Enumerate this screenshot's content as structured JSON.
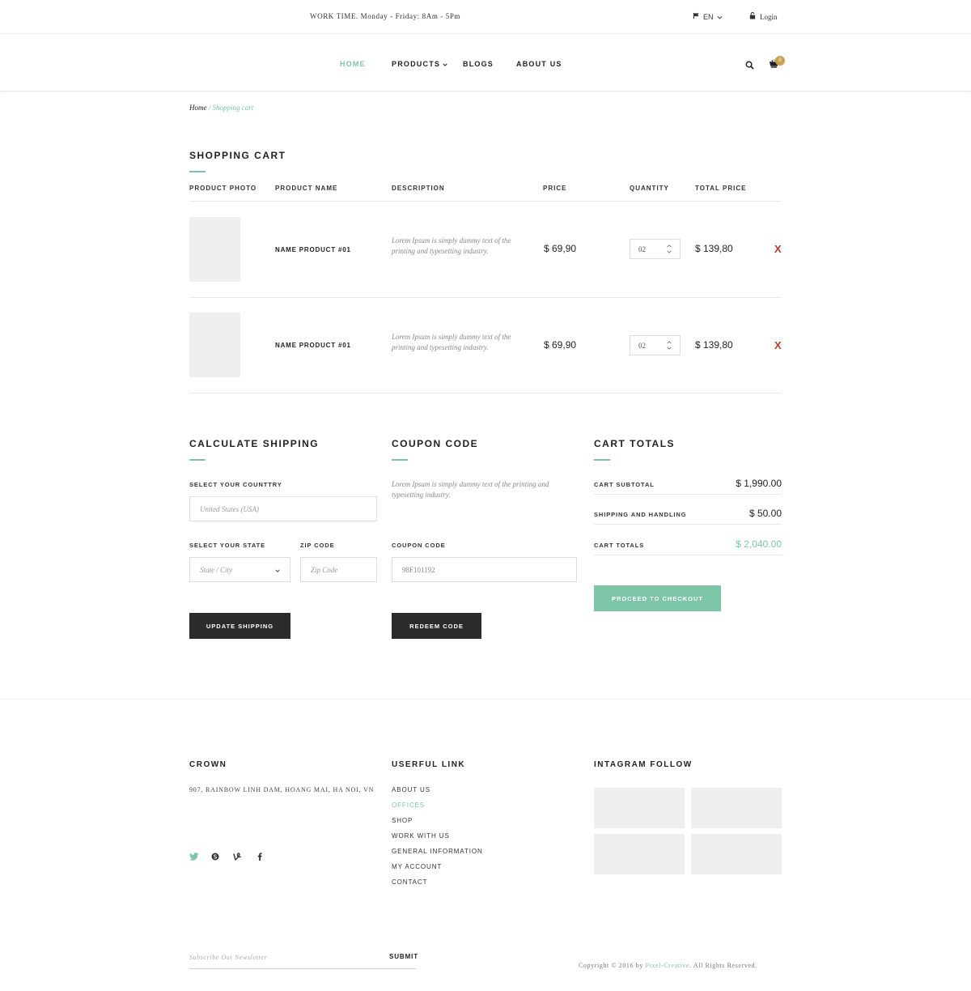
{
  "topbar": {
    "work_time": "WORK TIME. Monday - Friday: 8Am - 5Pm",
    "language": "EN",
    "login": "Login"
  },
  "nav": {
    "items": [
      {
        "label": "HOME",
        "active": true
      },
      {
        "label": "PRODUCTS",
        "has_dropdown": true
      },
      {
        "label": "BLOGS"
      },
      {
        "label": "ABOUT US"
      }
    ],
    "cart_count": "0"
  },
  "breadcrumb": {
    "home": "Home",
    "separator": " / ",
    "current": "Shopping cart"
  },
  "cart": {
    "title": "SHOPPING CART",
    "headers": {
      "photo": "PRODUCT PHOTO",
      "name": "PRODUCT NAME",
      "description": "DESCRIPTION",
      "price": "PRICE",
      "quantity": "QUANTITY",
      "total": "TOTAL PRICE"
    },
    "items": [
      {
        "name": "NAME PRODUCT #01",
        "description": "Lorem Ipsum is simply dummy text of the printing and typesetting industry.",
        "price": "$ 69,90",
        "quantity": "02",
        "total": "$ 139,80",
        "remove": "X"
      },
      {
        "name": "NAME PRODUCT #01",
        "description": "Lorem Ipsum is simply dummy text of the printing and typesetting industry.",
        "price": "$ 69,90",
        "quantity": "02",
        "total": "$ 139,80",
        "remove": "X"
      }
    ]
  },
  "shipping": {
    "title": "CALCULATE SHIPPING",
    "country_label": "SELECT YOUR COUNTTRY",
    "country_value": "United States (USA)",
    "state_label": "SELECT YOUR STATE",
    "state_placeholder": "State / City",
    "zip_label": "ZIP CODE",
    "zip_placeholder": "Zip Code",
    "button": "UPDATE SHIPPING"
  },
  "coupon": {
    "title": "COUPON CODE",
    "description": "Lorem Ipsum is simply dummy text of the printing and typesetting industry.",
    "label": "COUPON CODE",
    "value": "98F101192",
    "button": "REDEEM CODE"
  },
  "totals": {
    "title": "CART TOTALS",
    "subtotal_label": "CART SUBTOTAL",
    "subtotal_value": "$ 1,990.00",
    "shipping_label": "SHIPPING AND HANDLING",
    "shipping_value": "$ 50.00",
    "total_label": "CART TOTALS",
    "total_value": "$ 2,040.00",
    "checkout_button": "PROCEED TO CHECKOUT"
  },
  "footer": {
    "crown_title": "CROWN",
    "address": "907, RAINBOW LINH DAM, HOANG MAI, HA NOI, VN",
    "social": [
      "twitter-icon",
      "skype-icon",
      "vine-icon",
      "facebook-icon"
    ],
    "links_title": "USERFUL LINK",
    "links": [
      {
        "label": "ABOUT US"
      },
      {
        "label": "OFFICES",
        "active": true
      },
      {
        "label": "SHOP"
      },
      {
        "label": "WORK WITH US"
      },
      {
        "label": "GENERAL INFORMATION"
      },
      {
        "label": "MY ACCOUNT"
      },
      {
        "label": "CONTACT"
      }
    ],
    "instagram_title": "INTAGRAM FOLLOW",
    "newsletter_placeholder": "Subscribe Out Newsletter",
    "newsletter_button": "SUBMIT",
    "copyright_prefix": "Copyright © 2016 by ",
    "copyright_brand": "Pixel-Creative",
    "copyright_suffix": ". All Rights Reserved."
  },
  "colors": {
    "accent": "#7cc5a6",
    "dark_button": "#2b2b2b",
    "remove": "#c0392b",
    "badge": "#c7a24b"
  }
}
